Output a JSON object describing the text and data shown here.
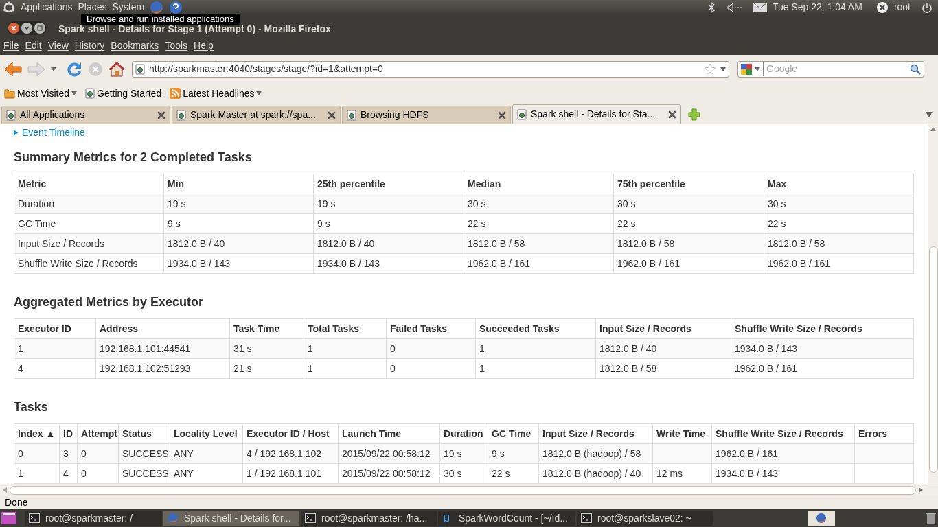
{
  "top_panel": {
    "menus": [
      "Applications",
      "Places",
      "System"
    ],
    "tooltip": "Browse and run installed applications",
    "clock": "Tue Sep 22,  1:04 AM",
    "user": "root"
  },
  "window": {
    "title": "Spark shell - Details for Stage 1 (Attempt 0) - Mozilla Firefox"
  },
  "menu_bar": [
    "File",
    "Edit",
    "View",
    "History",
    "Bookmarks",
    "Tools",
    "Help"
  ],
  "url": "http://sparkmaster:4040/stages/stage/?id=1&attempt=0",
  "search": {
    "placeholder": "Google"
  },
  "bookmarks": [
    {
      "label": "Most Visited",
      "dropdown": true,
      "kind": "folder"
    },
    {
      "label": "Getting Started",
      "dropdown": false,
      "kind": "page"
    },
    {
      "label": "Latest Headlines",
      "dropdown": true,
      "kind": "feed"
    }
  ],
  "tabs": [
    {
      "label": "All Applications",
      "selected": false
    },
    {
      "label": "Spark Master at spark://spa...",
      "selected": false
    },
    {
      "label": "Browsing HDFS",
      "selected": false
    },
    {
      "label": "Spark shell - Details for Sta...",
      "selected": true
    }
  ],
  "page": {
    "timeline_link": "Event Timeline",
    "summary": {
      "title": "Summary Metrics for 2 Completed Tasks",
      "columns": [
        "Metric",
        "Min",
        "25th percentile",
        "Median",
        "75th percentile",
        "Max"
      ],
      "rows": [
        [
          "Duration",
          "19 s",
          "19 s",
          "30 s",
          "30 s",
          "30 s"
        ],
        [
          "GC Time",
          "9 s",
          "9 s",
          "22 s",
          "22 s",
          "22 s"
        ],
        [
          "Input Size / Records",
          "1812.0 B / 40",
          "1812.0 B / 40",
          "1812.0 B / 58",
          "1812.0 B / 58",
          "1812.0 B / 58"
        ],
        [
          "Shuffle Write Size / Records",
          "1934.0 B / 143",
          "1934.0 B / 143",
          "1962.0 B / 161",
          "1962.0 B / 161",
          "1962.0 B / 161"
        ]
      ]
    },
    "executors": {
      "title": "Aggregated Metrics by Executor",
      "columns": [
        "Executor ID",
        "Address",
        "Task Time",
        "Total Tasks",
        "Failed Tasks",
        "Succeeded Tasks",
        "Input Size / Records",
        "Shuffle Write Size / Records"
      ],
      "rows": [
        [
          "1",
          "192.168.1.101:44541",
          "31 s",
          "1",
          "0",
          "1",
          "1812.0 B / 40",
          "1934.0 B / 143"
        ],
        [
          "4",
          "192.168.1.102:51293",
          "21 s",
          "1",
          "0",
          "1",
          "1812.0 B / 58",
          "1962.0 B / 161"
        ]
      ]
    },
    "tasks": {
      "title": "Tasks",
      "sort_mark": "▲",
      "columns": [
        "Index",
        "ID",
        "Attempt",
        "Status",
        "Locality Level",
        "Executor ID / Host",
        "Launch Time",
        "Duration",
        "GC Time",
        "Input Size / Records",
        "Write Time",
        "Shuffle Write Size / Records",
        "Errors"
      ],
      "rows": [
        [
          "0",
          "3",
          "0",
          "SUCCESS",
          "ANY",
          "4 / 192.168.1.102",
          "2015/09/22 00:58:12",
          "19 s",
          "9 s",
          "1812.0 B (hadoop) / 58",
          "",
          "1962.0 B / 161",
          ""
        ],
        [
          "1",
          "4",
          "0",
          "SUCCESS",
          "ANY",
          "1 / 192.168.1.101",
          "2015/09/22 00:58:12",
          "30 s",
          "22 s",
          "1812.0 B (hadoop) / 40",
          "12 ms",
          "1934.0 B / 143",
          ""
        ]
      ]
    }
  },
  "status_bar": "Done",
  "taskbar": [
    {
      "label": "root@sparkmaster: /",
      "kind": "terminal",
      "selected": false
    },
    {
      "label": "Spark shell - Details for...",
      "kind": "browser",
      "selected": true
    },
    {
      "label": "root@sparkmaster: /ha...",
      "kind": "terminal",
      "selected": false
    },
    {
      "label": "SparkWordCount - [~/Id...",
      "kind": "ide",
      "selected": false
    },
    {
      "label": "root@sparkslave02: ~",
      "kind": "terminal",
      "selected": false
    }
  ]
}
